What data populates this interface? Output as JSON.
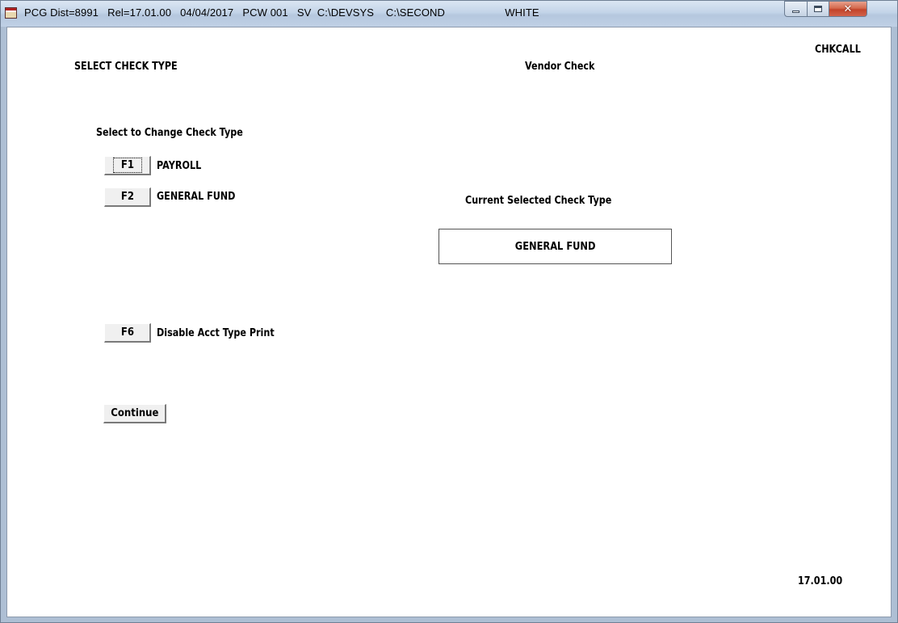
{
  "window": {
    "title": "PCG Dist=8991   Rel=17.01.00   04/04/2017   PCW 001   SV  C:\\DEVSYS    C:\\SECOND                    WHITE",
    "controls": {
      "minimize": "minimize",
      "maximize": "maximize",
      "close": "close"
    }
  },
  "screen": {
    "heading": "SELECT CHECK TYPE",
    "mode": "Vendor Check",
    "program_id": "CHKCALL",
    "instruction": "Select to Change Check Type",
    "options": [
      {
        "key": "F1",
        "label": "PAYROLL"
      },
      {
        "key": "F2",
        "label": "GENERAL FUND"
      }
    ],
    "current_label": "Current Selected Check Type",
    "current_value": "GENERAL FUND",
    "f6": {
      "key": "F6",
      "label": "Disable Acct Type Print"
    },
    "continue_label": "Continue",
    "version": "17.01.00"
  },
  "colors": {
    "close_button": "#c2432a",
    "titlebar": "#c3d4e8",
    "button_face": "#f0f0f0"
  }
}
